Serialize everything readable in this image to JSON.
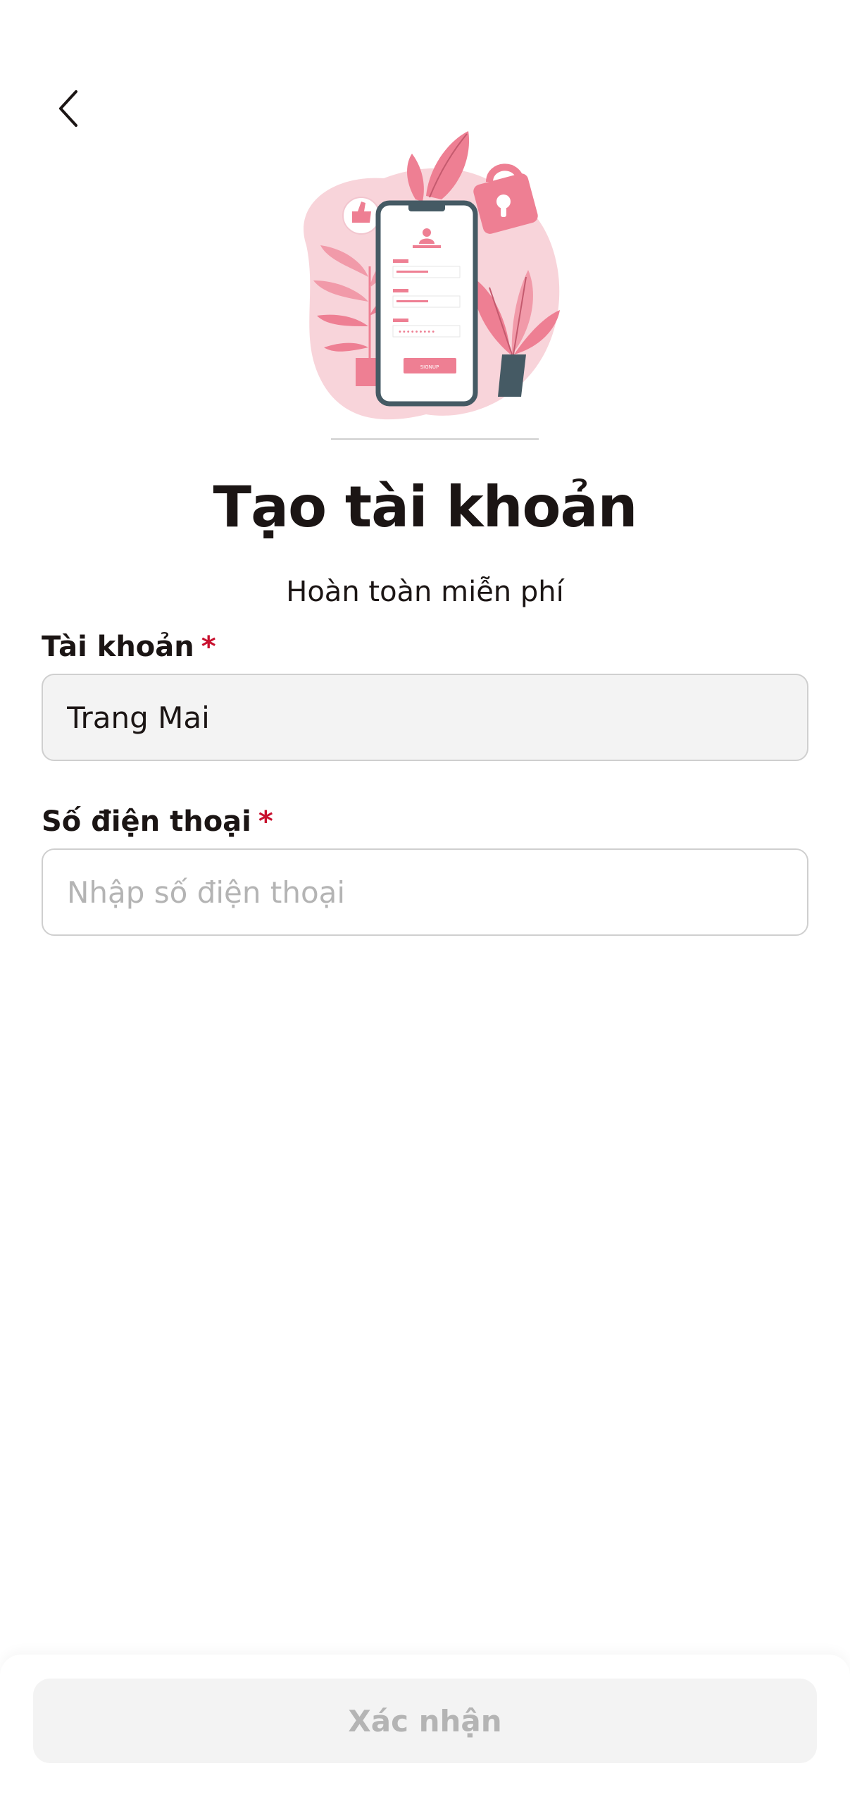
{
  "header": {
    "back_icon": "chevron-left-icon"
  },
  "illustration": {
    "icon": "phone-signup-illustration",
    "phone_button_label": "SIGNUP"
  },
  "page": {
    "title": "Tạo tài khoản",
    "subtitle": "Hoàn toàn miễn phí"
  },
  "form": {
    "account": {
      "label": "Tài khoản",
      "required_mark": "*",
      "value": "Trang Mai"
    },
    "phone": {
      "label": "Số điện thoại",
      "required_mark": "*",
      "value": "",
      "placeholder": "Nhập số điện thoại"
    }
  },
  "footer": {
    "confirm_label": "Xác nhận"
  },
  "colors": {
    "accent_pink": "#ee7f93",
    "light_pink": "#f8d4da",
    "dark_slate": "#455a64",
    "required_red": "#c8102e",
    "text_primary": "#1b1514",
    "disabled_text": "#b4b4b4",
    "disabled_bg": "#f3f3f3"
  }
}
